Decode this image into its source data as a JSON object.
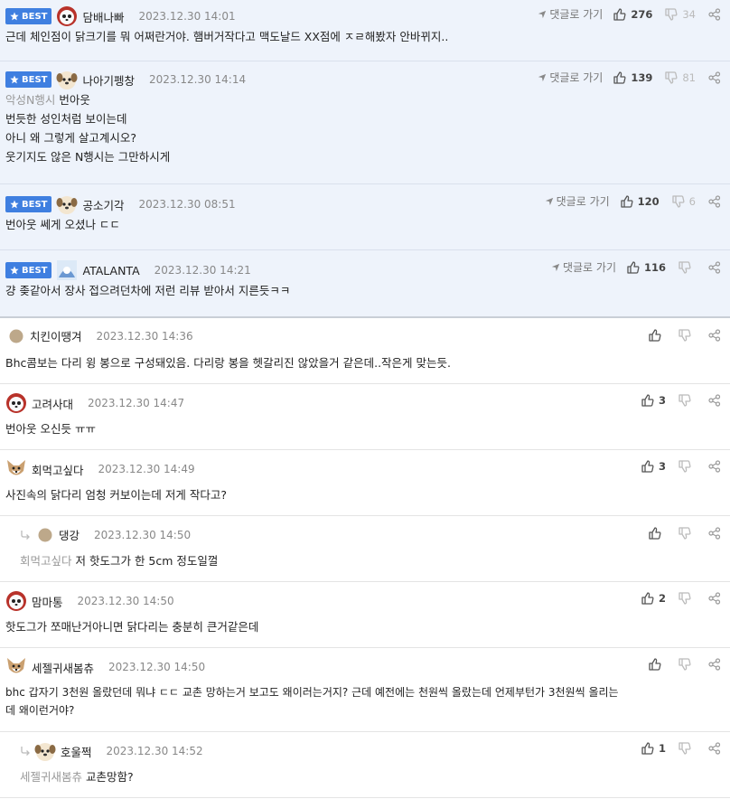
{
  "labels": {
    "best": "BEST",
    "goto": "댓글로 가기"
  },
  "comments": [
    {
      "nick": "담배나빠",
      "time": "2023.12.30 14:01",
      "up": "276",
      "down": "34",
      "text": [
        "근데 체인점이 닭크기를 뭐 어쩌란거야. 햄버거작다고 맥도날드 XX점에 ㅈㄹ해봤자 안바뀌지.."
      ]
    },
    {
      "nick": "나아기펭창",
      "time": "2023.12.30 14:14",
      "up": "139",
      "down": "81",
      "mention": "악성N행시",
      "text": [
        "번아웃",
        "번듯한 성인처럼 보이는데",
        "아니 왜 그렇게 살고계시오?",
        "웃기지도 않은 N행시는 그만하시게"
      ]
    },
    {
      "nick": "공소기각",
      "time": "2023.12.30 08:51",
      "up": "120",
      "down": "6",
      "text": [
        "번아웃 쎄게 오셨나 ㄷㄷ"
      ]
    },
    {
      "nick": "ATALANTA",
      "time": "2023.12.30 14:21",
      "up": "116",
      "down": "",
      "text": [
        "걍 좆같아서 장사 접으려던차에 저런 리뷰 받아서 지른듯ㅋㅋ"
      ]
    },
    {
      "nick": "치킨이땡겨",
      "time": "2023.12.30 14:36",
      "up": "",
      "text": [
        "Bhc콤보는 다리 윙 봉으로 구성돼있음. 다리랑 봉을 헷갈리진 않았을거 같은데..작은게 맞는듯."
      ]
    },
    {
      "nick": "고려사대",
      "time": "2023.12.30 14:47",
      "up": "3",
      "text": [
        "번아웃 오신듯 ㅠㅠ"
      ]
    },
    {
      "nick": "회먹고싶다",
      "time": "2023.12.30 14:49",
      "up": "3",
      "text": [
        "사진속의 닭다리 엄청 커보이는데 저게 작다고?"
      ]
    },
    {
      "nick": "댕강",
      "time": "2023.12.30 14:50",
      "up": "",
      "mention": "회먹고싶다",
      "text": [
        "저 핫도그가 한 5cm 정도일껄"
      ]
    },
    {
      "nick": "맘마통",
      "time": "2023.12.30 14:50",
      "up": "2",
      "text": [
        "핫도그가 쪼매난거아니면 닭다리는 충분히 큰거같은데"
      ]
    },
    {
      "nick": "세젤귀새봄츄",
      "time": "2023.12.30 14:50",
      "up": "",
      "text": [
        "bhc 갑자기 3천원 올랐던데 뭐냐 ㄷㄷ 교촌 망하는거 보고도 왜이러는거지? 근데 예전에는 천원씩 올랐는데 언제부턴가 3천원씩 올리는",
        "데 왜이런거야?"
      ]
    },
    {
      "nick": "호울쩍",
      "time": "2023.12.30 14:52",
      "up": "1",
      "mention": "세젤귀새봄츄",
      "text": [
        "교촌망함?"
      ]
    }
  ]
}
